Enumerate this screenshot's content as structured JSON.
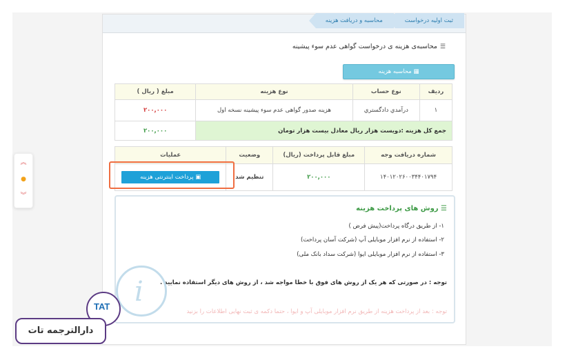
{
  "breadcrumb": {
    "steps": [
      "ثبت اولیه درخواست",
      "محاسبه و دریافت هزینه"
    ]
  },
  "section": {
    "title": "محاسبه‌ی هزینه ی درخواست گواهی عدم سوء پیشینه",
    "calc_button": "محاسبه هزینه"
  },
  "cost_table": {
    "headers": [
      "ردیف",
      "نوع حساب",
      "نوع هزینه",
      "مبلغ ( ریال )"
    ],
    "rows": [
      {
        "row": "۱",
        "account": "درآمدي دادگستري",
        "cost_type": "هزینه صدور گواهی عدم سوء پیشینه نسخه اول",
        "amount": "۲۰۰,۰۰۰"
      }
    ],
    "total_label": "جمع کل هزینه :دویست هزار ریال معادل بیست هزار تومان",
    "total_amount": "۲۰۰,۰۰۰"
  },
  "payment_table": {
    "headers": [
      "شماره دریافت وجه",
      "مبلغ قابل پرداخت (ریال)",
      "وضعیت",
      "عملیات"
    ],
    "row": {
      "receipt_number": "۱۴۰۱۲۰۲۶۰۰۳۴۴۰۱۷۹۴",
      "amount": "۲۰۰,۰۰۰",
      "status": "تنظیم شد",
      "action_label": "پرداخت اینترنتی هزینه"
    }
  },
  "payment_methods": {
    "title": "روش های پرداخت هزینه",
    "items": [
      "۱- از طریق درگاه پرداخت(پیش فرض )",
      "۲- استفاده از نرم افزار موبایلی آپ (شرکت آسان پرداخت)",
      "۳- استفاده از نرم افزار موبایلی ایوا (شرکت سداد بانک ملی)"
    ],
    "note": "توجه : در صورتی که هر یک از روش های فوق با خطا مواجه شد ، از روش های دیگر استفاده نمایید .",
    "faded_note": "توجه : بعد از پرداخت هزینه از طریق نرم افزار موبایلی آپ و ایوا ، حتما دکمه ی ثبت نهایی اطلاعات را بزنید"
  },
  "branding": {
    "logo_text": "TAT",
    "name": "دارالترجمه تات"
  },
  "colors": {
    "accent": "#1ea1d8",
    "highlight": "#ef6d40",
    "amount_red": "#d43a3a",
    "amount_green": "#3d9a45"
  }
}
